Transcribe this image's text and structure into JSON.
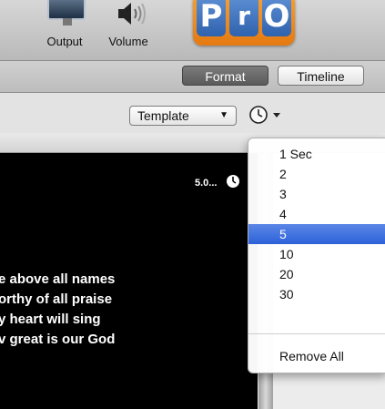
{
  "toolbar": {
    "output_label": "Output",
    "volume_label": "Volume",
    "logo_letters": [
      "P",
      "r",
      "O"
    ]
  },
  "mode": {
    "format_label": "Format",
    "timeline_label": "Timeline",
    "selected": "Format"
  },
  "options": {
    "template_label": "Template",
    "clock_icon": "clock-icon"
  },
  "preview": {
    "duration": "5.0...",
    "lines": [
      "e above all names",
      "orthy of all praise",
      "y heart will sing",
      "v great is our God"
    ]
  },
  "menu": {
    "items": [
      "1 Sec",
      "2",
      "3",
      "4",
      "5",
      "10",
      "20",
      "30"
    ],
    "selected": "5",
    "remove_all": "Remove All"
  },
  "colors": {
    "selection": "#2c62d9",
    "logo_orange": "#e47912",
    "logo_blue": "#2f63ad"
  }
}
